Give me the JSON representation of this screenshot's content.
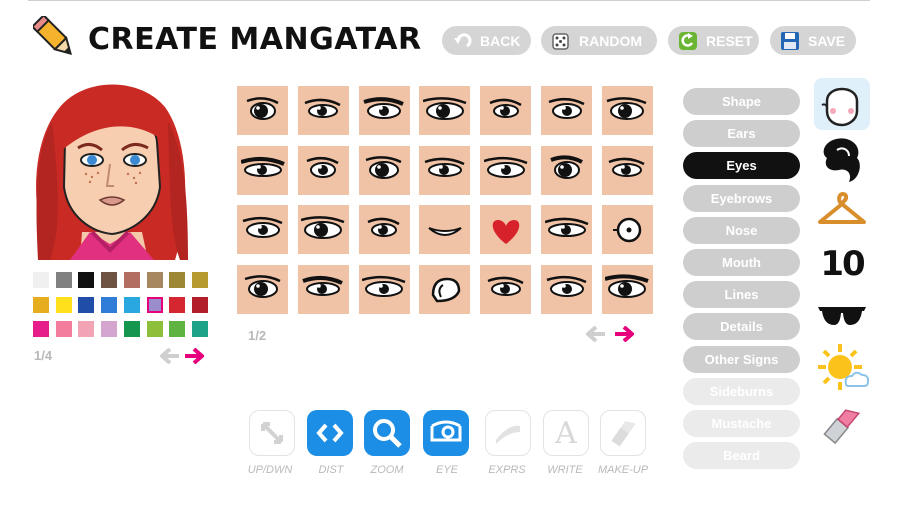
{
  "header": {
    "title": "CREATE MANGATAR",
    "buttons": [
      {
        "label": "BACK",
        "icon": "back-arrow-icon"
      },
      {
        "label": "RANDOM",
        "icon": "dice-icon"
      },
      {
        "label": "RESET",
        "icon": "reset-icon"
      },
      {
        "label": "SAVE",
        "icon": "floppy-disk-icon"
      }
    ]
  },
  "palette": {
    "colors": [
      "#f0f0f0",
      "#808080",
      "#111111",
      "#6e5242",
      "#b36e62",
      "#a6875f",
      "#9e8734",
      "#b59a2d",
      "#e6ad1e",
      "#ffe01a",
      "#1f4da8",
      "#2f7dd6",
      "#29a8e0",
      "#9b8dcc",
      "#d4272f",
      "#b21f2b",
      "#e61e8c",
      "#f27d9c",
      "#f2a3b4",
      "#d4a6cf",
      "#14964e",
      "#8dbf3a",
      "#5fb340",
      "#1fa388"
    ],
    "selected_index": 13,
    "page": "1/4"
  },
  "eye_grid": {
    "page": "1/2",
    "bg_color": "#f1c3a6",
    "special_cells": {
      "heart": 18,
      "circle_eye": 20,
      "closed_smile": 17
    }
  },
  "tools": [
    {
      "label": "UP/DWN",
      "icon": "up-down-arrows-icon",
      "active": false
    },
    {
      "label": "DIST",
      "icon": "distance-arrows-icon",
      "active": true
    },
    {
      "label": "ZOOM",
      "icon": "magnifier-icon",
      "active": true
    },
    {
      "label": "EYE",
      "icon": "eye-icon",
      "active": true
    },
    {
      "label": "EXPRS",
      "icon": "expression-icon",
      "active": false
    },
    {
      "label": "WRITE",
      "icon": "letter-a-icon",
      "active": false
    },
    {
      "label": "MAKE-UP",
      "icon": "lipstick-icon",
      "active": false
    }
  ],
  "categories": [
    {
      "label": "Shape",
      "state": "normal"
    },
    {
      "label": "Ears",
      "state": "normal"
    },
    {
      "label": "Eyes",
      "state": "active"
    },
    {
      "label": "Eyebrows",
      "state": "normal"
    },
    {
      "label": "Nose",
      "state": "normal"
    },
    {
      "label": "Mouth",
      "state": "normal"
    },
    {
      "label": "Lines",
      "state": "normal"
    },
    {
      "label": "Details",
      "state": "normal"
    },
    {
      "label": "Other Signs",
      "state": "normal"
    },
    {
      "label": "Sideburns",
      "state": "disabled"
    },
    {
      "label": "Mustache",
      "state": "disabled"
    },
    {
      "label": "Beard",
      "state": "disabled"
    }
  ],
  "side_tabs": [
    {
      "icon": "face-icon",
      "active": true
    },
    {
      "icon": "hair-icon",
      "active": false
    },
    {
      "icon": "hanger-icon",
      "active": false
    },
    {
      "icon": "number-ten-icon",
      "label": "10",
      "active": false
    },
    {
      "icon": "sunglasses-icon",
      "active": false
    },
    {
      "icon": "sun-cloud-icon",
      "active": false
    },
    {
      "icon": "lipstick-icon",
      "active": false
    }
  ],
  "colors": {
    "accent": "#e6007e",
    "tool_active": "#1c8ee6",
    "button_gray": "#d5d5d5",
    "category_active": "#111111"
  }
}
